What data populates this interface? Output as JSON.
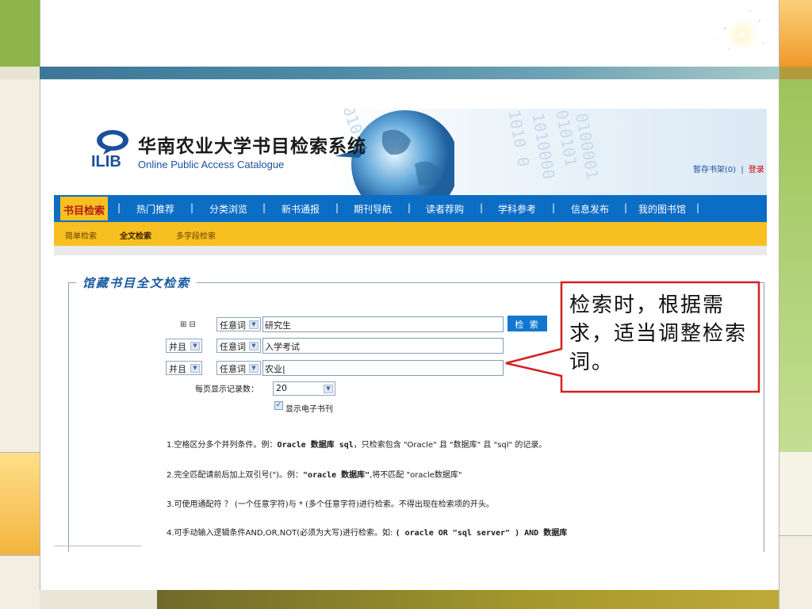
{
  "site": {
    "logo_text": "ILIB",
    "title": "华南农业大学书目检索系统",
    "subtitle": "Online Public Access Catalogue",
    "cart_label": "暂存书架(0)",
    "cart_sep": "|",
    "login_label": "登录",
    "digits": [
      "0101010",
      "1010000",
      "010101",
      "0100001",
      "1010 0"
    ]
  },
  "nav": {
    "items": [
      "书目检索",
      "热门推荐",
      "分类浏览",
      "新书通报",
      "期刊导航",
      "读者荐购",
      "学科参考",
      "信息发布",
      "我的图书馆"
    ],
    "separator": "|"
  },
  "subnav": {
    "items": [
      "简单检索",
      "全文检索",
      "多字段检索"
    ],
    "active": "全文检索"
  },
  "panel": {
    "title": "馆藏书目全文检索",
    "toggle": "⊞ ⊟",
    "rows": [
      {
        "logic": "",
        "field": "任意词",
        "value": "研究生"
      },
      {
        "logic": "并且",
        "field": "任意词",
        "value": "入学考试"
      },
      {
        "logic": "并且",
        "field": "任意词",
        "value": "农业|"
      }
    ],
    "search_button": "检 索",
    "per_page_label": "每页显示记录数：",
    "per_page_value": "20",
    "show_ejournal_label": "显示电子书刊",
    "show_ejournal_checked": true
  },
  "hints": [
    {
      "pre": "1.空格区分多个并列条件。例：",
      "code": "Oracle 数据库 sql",
      "post": "，只检索包含 \"Oracle\" 且 \"数据库\" 且 \"sql\" 的记录。"
    },
    {
      "pre": "2.完全匹配请前后加上双引号(\")。例：",
      "code": "\"oracle 数据库\"",
      "post": ",将不匹配 \"oracle数据库\""
    },
    {
      "pre": "3.可使用通配符 ？ (一个任意字符)与 * (多个任意字符)进行检索。不得出现在检索项的开头。",
      "code": "",
      "post": ""
    },
    {
      "pre": "4.可手动输入逻辑条件AND,OR,NOT(必须为大写)进行检索。如: ",
      "code": "( oracle OR \"sql server\" ) AND 数据库",
      "post": ""
    }
  ],
  "callout": {
    "text": "检索时，根据需求，适当调整检索词。",
    "border_color": "#d42020"
  },
  "colors": {
    "nav_blue": "#0c6dc4",
    "nav_active_bg": "#f7c020",
    "subnav_bg": "#f7c020",
    "slide_green": "#8db548",
    "slide_orange": "#f09a2a"
  }
}
